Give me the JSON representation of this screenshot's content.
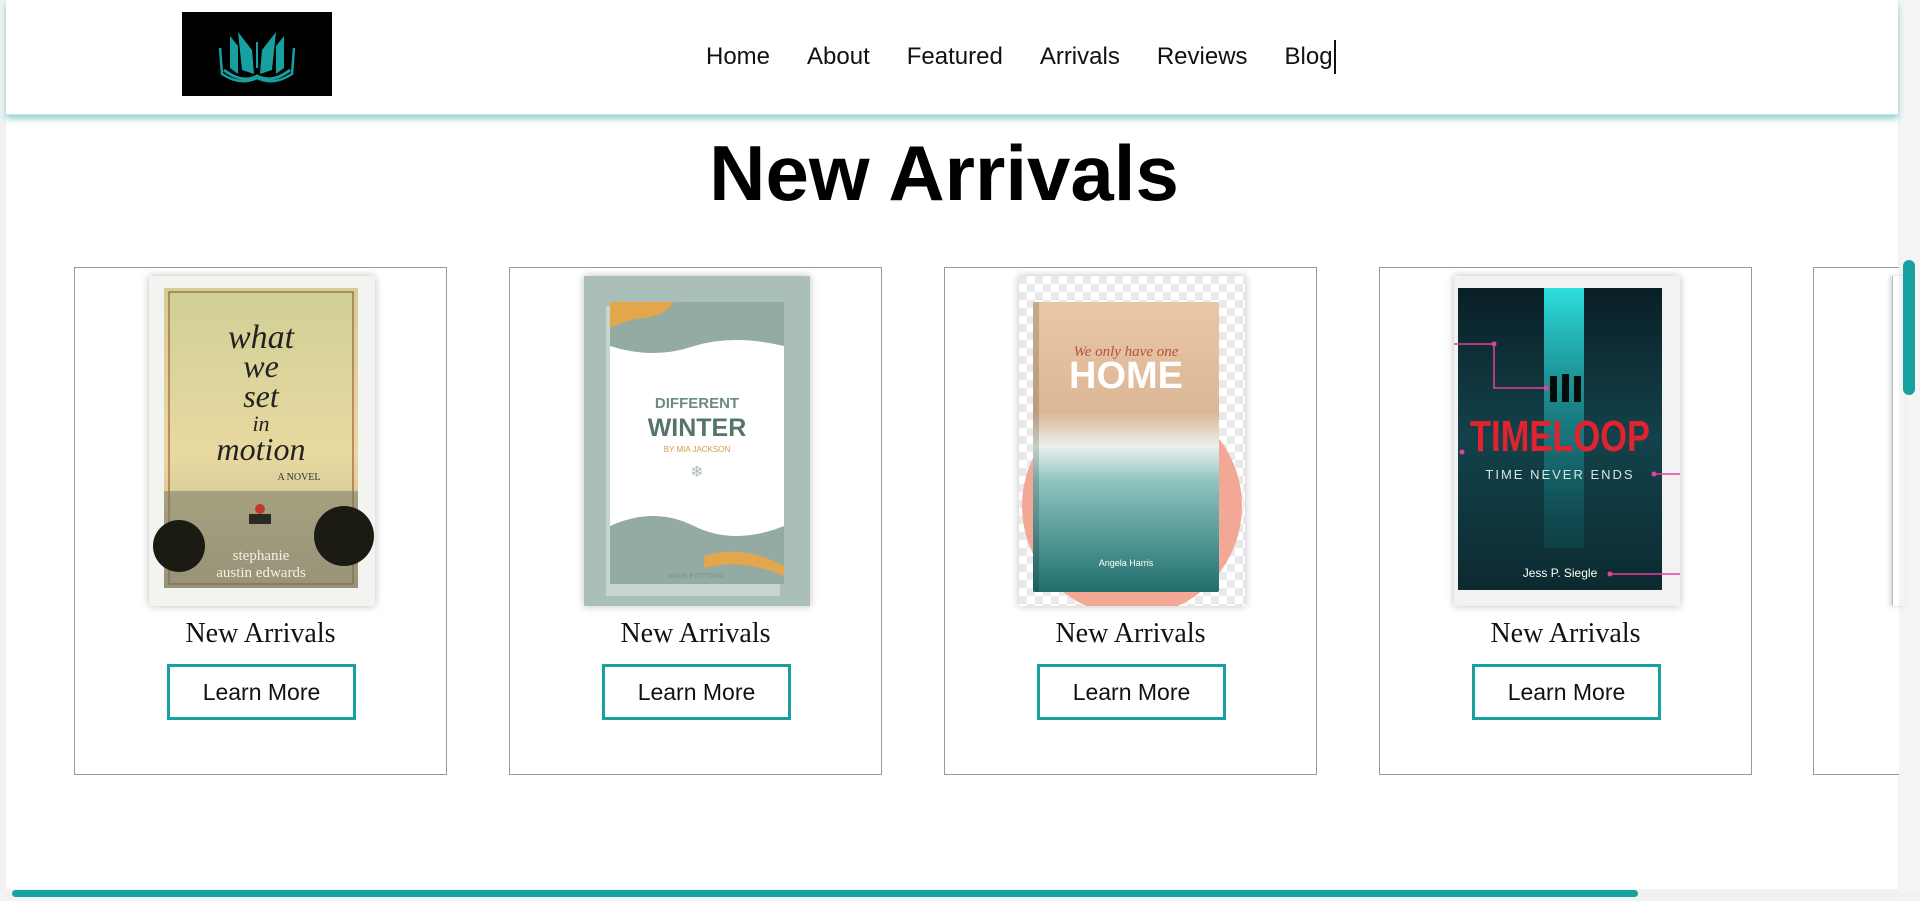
{
  "header": {
    "logo_icon": "open-book-icon",
    "colors": {
      "accent": "#16a0a0",
      "logo_bg": "#000000"
    },
    "nav": [
      {
        "label": "Home"
      },
      {
        "label": "About"
      },
      {
        "label": "Featured"
      },
      {
        "label": "Arrivals"
      },
      {
        "label": "Reviews"
      },
      {
        "label": "Blog"
      }
    ]
  },
  "section": {
    "title": "New Arrivals"
  },
  "cards": [
    {
      "caption": "New Arrivals",
      "button": "Learn More",
      "cover": {
        "title_lines": [
          "what",
          "we",
          "set",
          "in",
          "motion"
        ],
        "subtitle": "A NOVEL",
        "author_lines": [
          "stephanie",
          "austin edwards"
        ]
      }
    },
    {
      "caption": "New Arrivals",
      "button": "Learn More",
      "cover": {
        "title_lines": [
          "DIFFERENT",
          "WINTER"
        ],
        "subtitle": "BY MIA JACKSON",
        "footer": "NAME EDITORIAL"
      }
    },
    {
      "caption": "New Arrivals",
      "button": "Learn More",
      "cover": {
        "title_lines": [
          "We only have one",
          "HOME"
        ],
        "author": "Angela Harris"
      }
    },
    {
      "caption": "New Arrivals",
      "button": "Learn More",
      "cover": {
        "title": "TIMELOOP",
        "subtitle": "TIME NEVER ENDS",
        "author": "Jess P. Siegle"
      }
    }
  ],
  "scroll": {
    "horizontal_fraction_visible": 0.86
  }
}
